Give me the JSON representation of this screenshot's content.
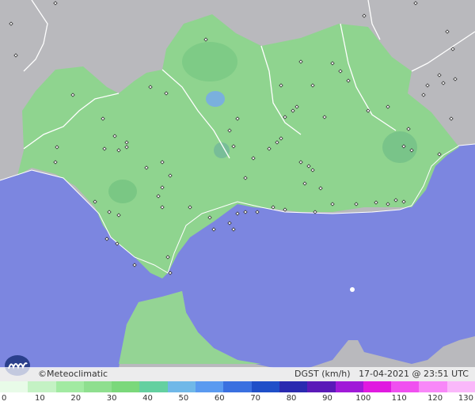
{
  "map": {
    "brand": "©Meteoclimatic",
    "variable": "DGST (km/h)",
    "timestamp": "17-04-2021 @ 23:51 UTC",
    "colors": {
      "sea": "#7c86e0",
      "land_region": "#8fd48f",
      "land_outside": "#b9b9bd",
      "border": "#ffffff"
    },
    "legend": {
      "ticks": [
        "0",
        "10",
        "20",
        "30",
        "40",
        "50",
        "60",
        "70",
        "80",
        "90",
        "100",
        "110",
        "120",
        "130"
      ],
      "colors": [
        "#e8fbe8",
        "#c4f2c4",
        "#a2eaa2",
        "#8fdf8f",
        "#7bd87b",
        "#64d0a0",
        "#70b8e8",
        "#5a9af0",
        "#3a70e0",
        "#1f4fc8",
        "#2a2ab0",
        "#5a1ab8",
        "#a01ad8",
        "#e01ae0",
        "#f050f0",
        "#f888f8",
        "#fab8fa"
      ]
    }
  }
}
